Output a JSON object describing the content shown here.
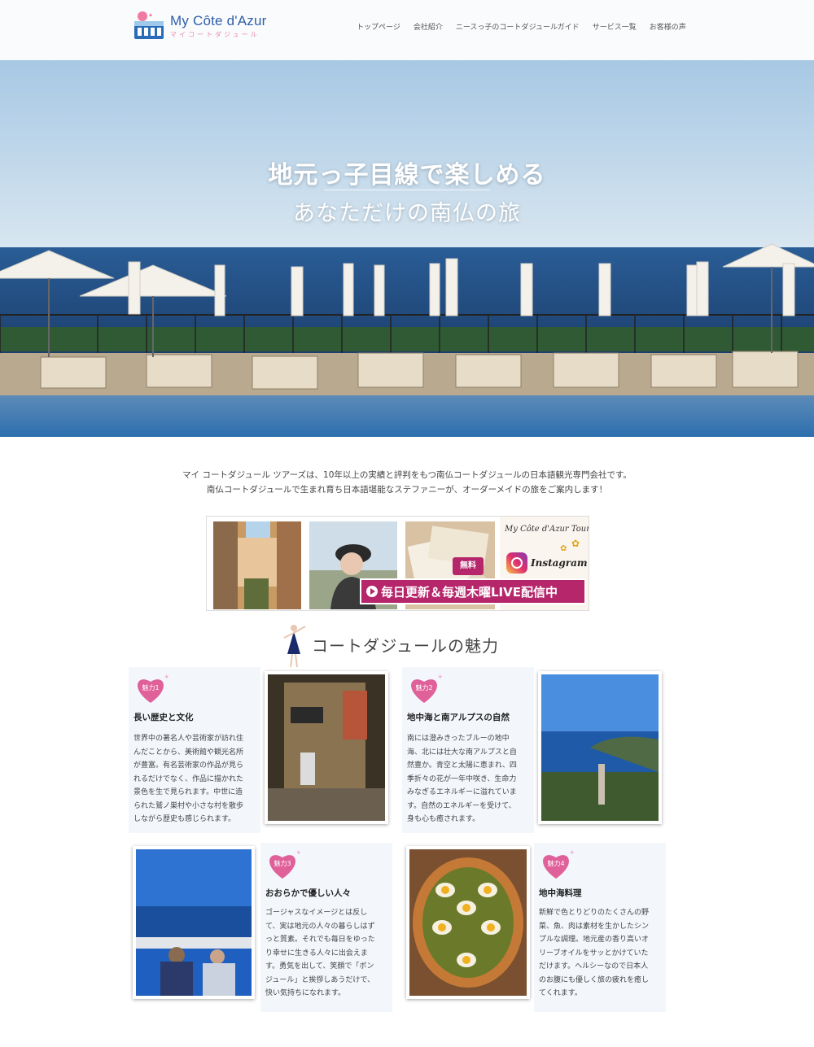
{
  "header": {
    "logo_main": "My Côte d'Azur",
    "logo_sub": "マイコートダジュール",
    "nav": [
      "トップページ",
      "会社紹介",
      "ニースっ子のコートダジュールガイド",
      "サービス一覧",
      "お客様の声"
    ]
  },
  "hero": {
    "title": "地元っ子目線で楽しめる",
    "subtitle": "あなただけの南仏の旅"
  },
  "intro": {
    "line1": "マイ コートダジュール ツアーズは、10年以上の実績と評判をもつ南仏コートダジュールの日本語観光専門会社です。",
    "line2": "南仏コートダジュールで生まれ育ち日本語堪能なステファニーが、オーダーメイドの旅をご案内します！"
  },
  "banner": {
    "script": "My Côte d'Azur Tours",
    "instagram": "Instagram",
    "free": "無料",
    "live": "毎日更新＆毎週木曜LIVE配信中"
  },
  "section": {
    "title": "コートダジュールの魅力"
  },
  "cards": [
    {
      "badge": "魅力1",
      "title": "長い歴史と文化",
      "lines": [
        "世界中の著名人や芸術家が訪れ住",
        "んだことから、美術館や観光名所",
        "が豊富。有名芸術家の作品が見ら",
        "れるだけでなく、作品に描かれた",
        "景色を生で見られます。中世に造",
        "られた鷲ノ巣村や小さな村を散歩",
        "しながら歴史も感じられます。"
      ]
    },
    {
      "badge": "魅力2",
      "title": "地中海と南アルプスの自然",
      "lines": [
        "南には澄みきったブルーの地中",
        "海、北には壮大な南アルプスと自",
        "然豊か。青空と太陽に恵まれ、四",
        "季折々の花が一年中咲き、生命力",
        "みなぎるエネルギーに溢れていま",
        "す。自然のエネルギーを受けて、",
        "身も心も癒されます。"
      ]
    },
    {
      "badge": "魅力3",
      "title": "おおらかで優しい人々",
      "lines": [
        "ゴージャスなイメージとは反し",
        "て、実は地元の人々の暮らしはず",
        "っと質素。それでも毎日をゆった",
        "り幸せに生きる人々に出会えま",
        "す。勇気を出して、笑顔で「ボン",
        "ジュール」と挨拶しあうだけで、",
        "快い気持ちになれます。"
      ]
    },
    {
      "badge": "魅力4",
      "title": "地中海料理",
      "lines": [
        "新鮮で色とりどりのたくさんの野",
        "菜、魚、肉は素材を生かしたシン",
        "プルな調理。地元産の香り高いオ",
        "リーブオイルをサッとかけていた",
        "だけます。ヘルシーなので日本人",
        "のお腹にも優しく旅の疲れを癒し",
        "てくれます。"
      ]
    }
  ],
  "colors": {
    "accent_pink": "#e0609a",
    "brand_blue": "#2d5fa8",
    "card_bg": "#f3f7fc",
    "live_magenta": "#b5266b"
  }
}
